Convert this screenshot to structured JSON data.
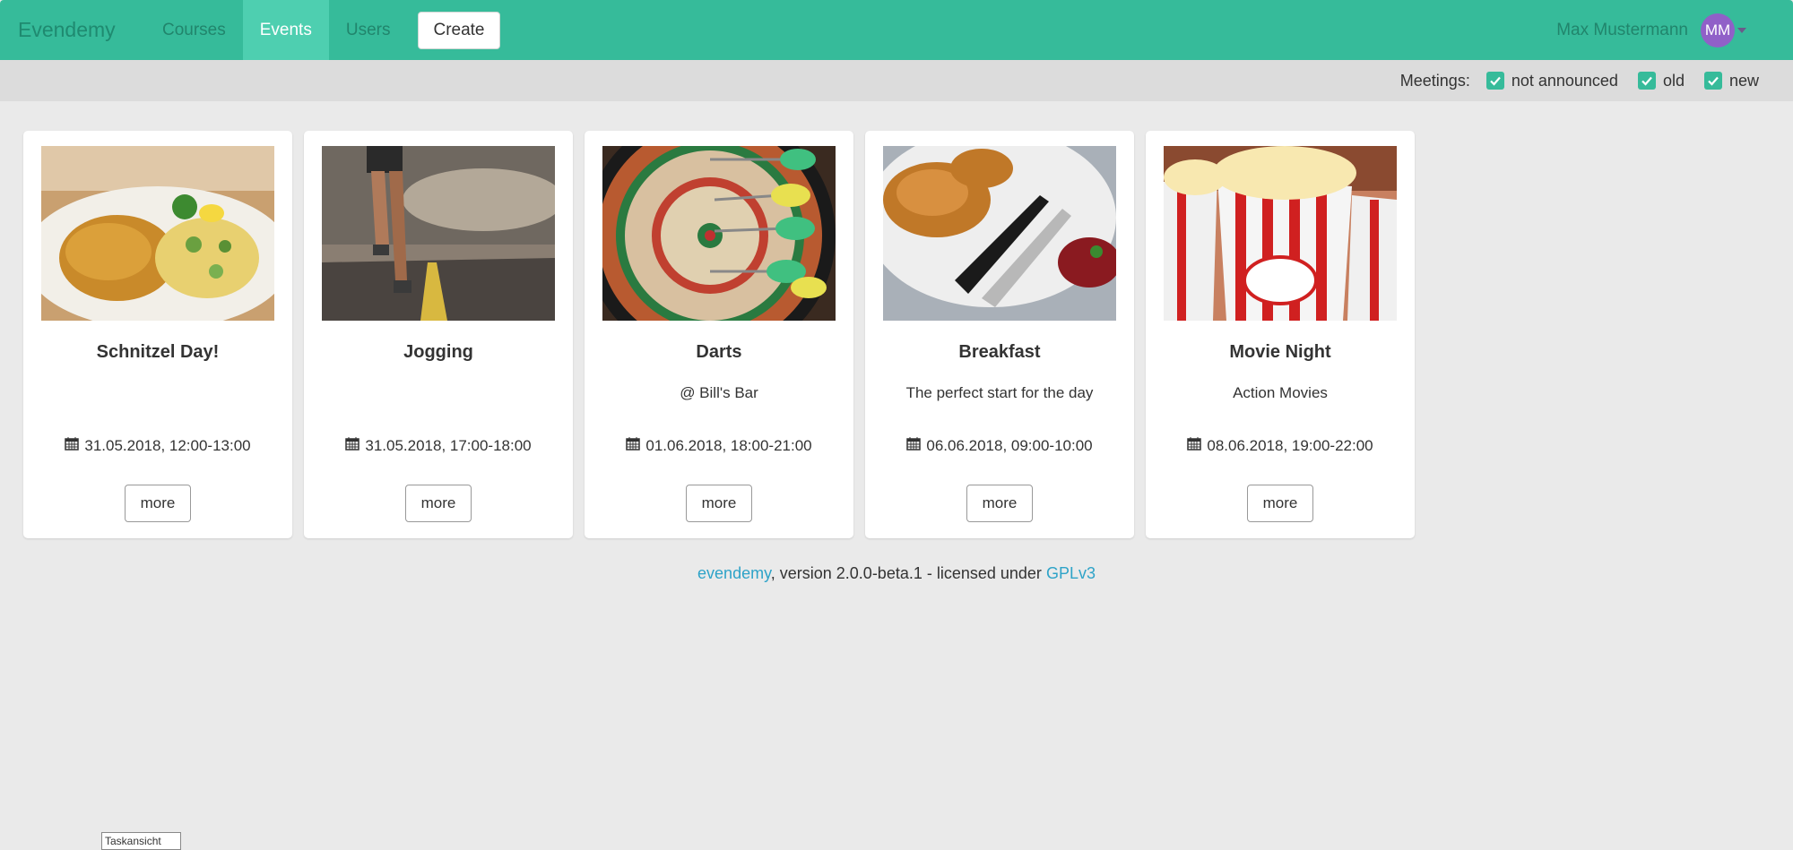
{
  "navbar": {
    "brand": "Evendemy",
    "items": [
      {
        "label": "Courses"
      },
      {
        "label": "Events"
      },
      {
        "label": "Users"
      }
    ],
    "create_label": "Create",
    "user_name": "Max Mustermann",
    "avatar_initials": "MM",
    "accent_color": "#36bb9a"
  },
  "filter": {
    "label": "Meetings:",
    "options": [
      {
        "label": "not announced",
        "checked": true
      },
      {
        "label": "old",
        "checked": true
      },
      {
        "label": "new",
        "checked": true
      }
    ]
  },
  "events": [
    {
      "title": "Schnitzel Day!",
      "subtitle": "",
      "date": "31.05.2018, 12:00-13:00",
      "button": "more",
      "image": "schnitzel-image"
    },
    {
      "title": "Jogging",
      "subtitle": "",
      "date": "31.05.2018, 17:00-18:00",
      "button": "more",
      "image": "jogging-image"
    },
    {
      "title": "Darts",
      "subtitle": "@ Bill's Bar",
      "date": "01.06.2018, 18:00-21:00",
      "button": "more",
      "image": "darts-image"
    },
    {
      "title": "Breakfast",
      "subtitle": "The perfect start for the day",
      "date": "06.06.2018, 09:00-10:00",
      "button": "more",
      "image": "breakfast-image"
    },
    {
      "title": "Movie Night",
      "subtitle": "Action Movies",
      "date": "08.06.2018, 19:00-22:00",
      "button": "more",
      "image": "popcorn-image"
    }
  ],
  "footer": {
    "app_link": "evendemy",
    "text": ", version 2.0.0-beta.1 - licensed under ",
    "license_link": "GPLv3"
  },
  "taskbar_tooltip": "Taskansicht"
}
